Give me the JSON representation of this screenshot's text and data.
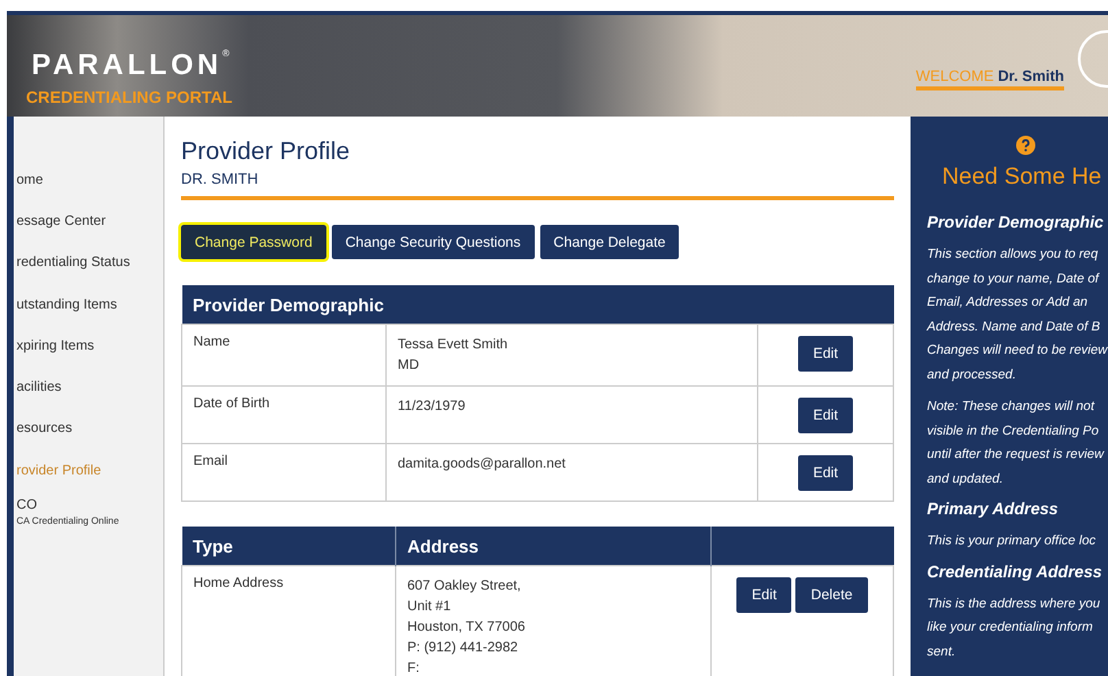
{
  "header": {
    "logo": "PARALLON",
    "logo_mark": "®",
    "tagline": "CREDENTIALING PORTAL",
    "welcome_label": "WELCOME",
    "welcome_name": "Dr. Smith"
  },
  "sidebar": {
    "items": [
      {
        "label": "ome",
        "selected": false
      },
      {
        "label": "essage Center",
        "selected": false
      },
      {
        "label": "redentialing Status",
        "selected": false
      },
      {
        "label": "utstanding Items",
        "selected": false
      },
      {
        "label": "xpiring Items",
        "selected": false
      },
      {
        "label": "acilities",
        "selected": false
      },
      {
        "label": "esources",
        "selected": false
      },
      {
        "label": "rovider Profile",
        "selected": true
      },
      {
        "label": "CO",
        "sub": "CA Credentialing Online",
        "selected": false
      }
    ]
  },
  "profile": {
    "title": "Provider Profile",
    "subtitle": "DR. SMITH"
  },
  "actions": [
    {
      "label": "Change Password",
      "selected": true
    },
    {
      "label": "Change Security Questions",
      "selected": false
    },
    {
      "label": "Change Delegate",
      "selected": false
    }
  ],
  "demographic": {
    "title": "Provider Demographic",
    "rows": [
      {
        "label": "Name",
        "values": [
          "Tessa Evett Smith",
          "MD"
        ],
        "button": "Edit"
      },
      {
        "label": "Date of Birth",
        "values": [
          "11/23/1979"
        ],
        "button": "Edit"
      },
      {
        "label": "Email",
        "values": [
          "damita.goods@parallon.net"
        ],
        "button": "Edit"
      }
    ]
  },
  "addresses": {
    "columns": [
      "Type",
      "Address"
    ],
    "rows": [
      {
        "type": "Home Address",
        "lines": [
          "607 Oakley Street,",
          "Unit #1",
          "Houston, TX 77006",
          "P: (912) 441-2982",
          "F:"
        ],
        "buttons": [
          "Edit",
          "Delete"
        ]
      }
    ]
  },
  "help": {
    "title": "Need Some He",
    "sections": [
      {
        "heading": "Provider Demographic",
        "paragraphs": [
          [
            "This section allows you to req",
            "change to your name, Date of",
            "Email, Addresses or Add an",
            "Address.  Name and Date of B",
            "Changes will need to be review",
            "and processed."
          ],
          [
            "Note:  These changes will not",
            "visible in the Credentialing Po",
            "until after the request is review",
            "and updated."
          ]
        ]
      },
      {
        "heading": "Primary Address",
        "paragraphs": [
          [
            "This is your primary office loc"
          ]
        ]
      },
      {
        "heading": "Credentialing Address",
        "paragraphs": [
          [
            "This is the address where you",
            "like your credentialing inform",
            "sent."
          ]
        ]
      }
    ]
  }
}
